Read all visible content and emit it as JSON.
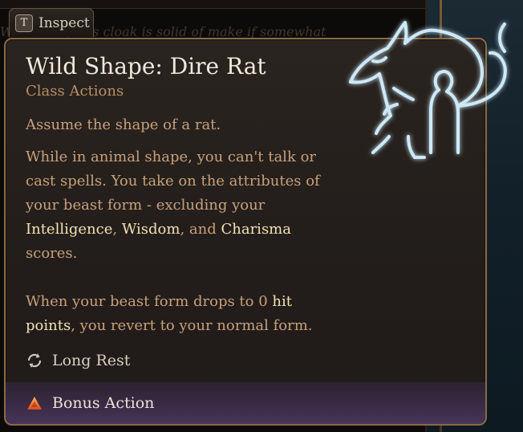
{
  "background": {
    "behind_text": "Wo... wool, this cloak is solid of make if somewhat"
  },
  "inspect": {
    "key": "T",
    "label": "Inspect"
  },
  "tooltip": {
    "title": "Wild Shape: Dire Rat",
    "subtitle": "Class Actions",
    "summary": "Assume the shape of a rat.",
    "description_lines": [
      "While in animal shape, you can't talk or",
      "cast spells. You take on the attributes of",
      "your beast form - excluding your"
    ],
    "attributes": [
      "Intelligence",
      "Wisdom",
      "Charisma"
    ],
    "sep_comma": ",",
    "sep_and": ", and",
    "scores_line": "scores.",
    "hp_line1_pre": "When your beast form drops to 0",
    "hp_keyword_1": "hit",
    "hp_keyword_2": "points",
    "hp_line2_post": ", you revert to your normal form.",
    "recharge": {
      "icon": "refresh-icon",
      "label": "Long Rest"
    },
    "action_cost": {
      "icon": "triangle-icon",
      "label": "Bonus Action",
      "color": "#e8612c"
    }
  },
  "colors": {
    "accent_text": "#c8a07a",
    "keyword": "#f2e1b2",
    "emblem_glow": "#bfe3f5"
  }
}
